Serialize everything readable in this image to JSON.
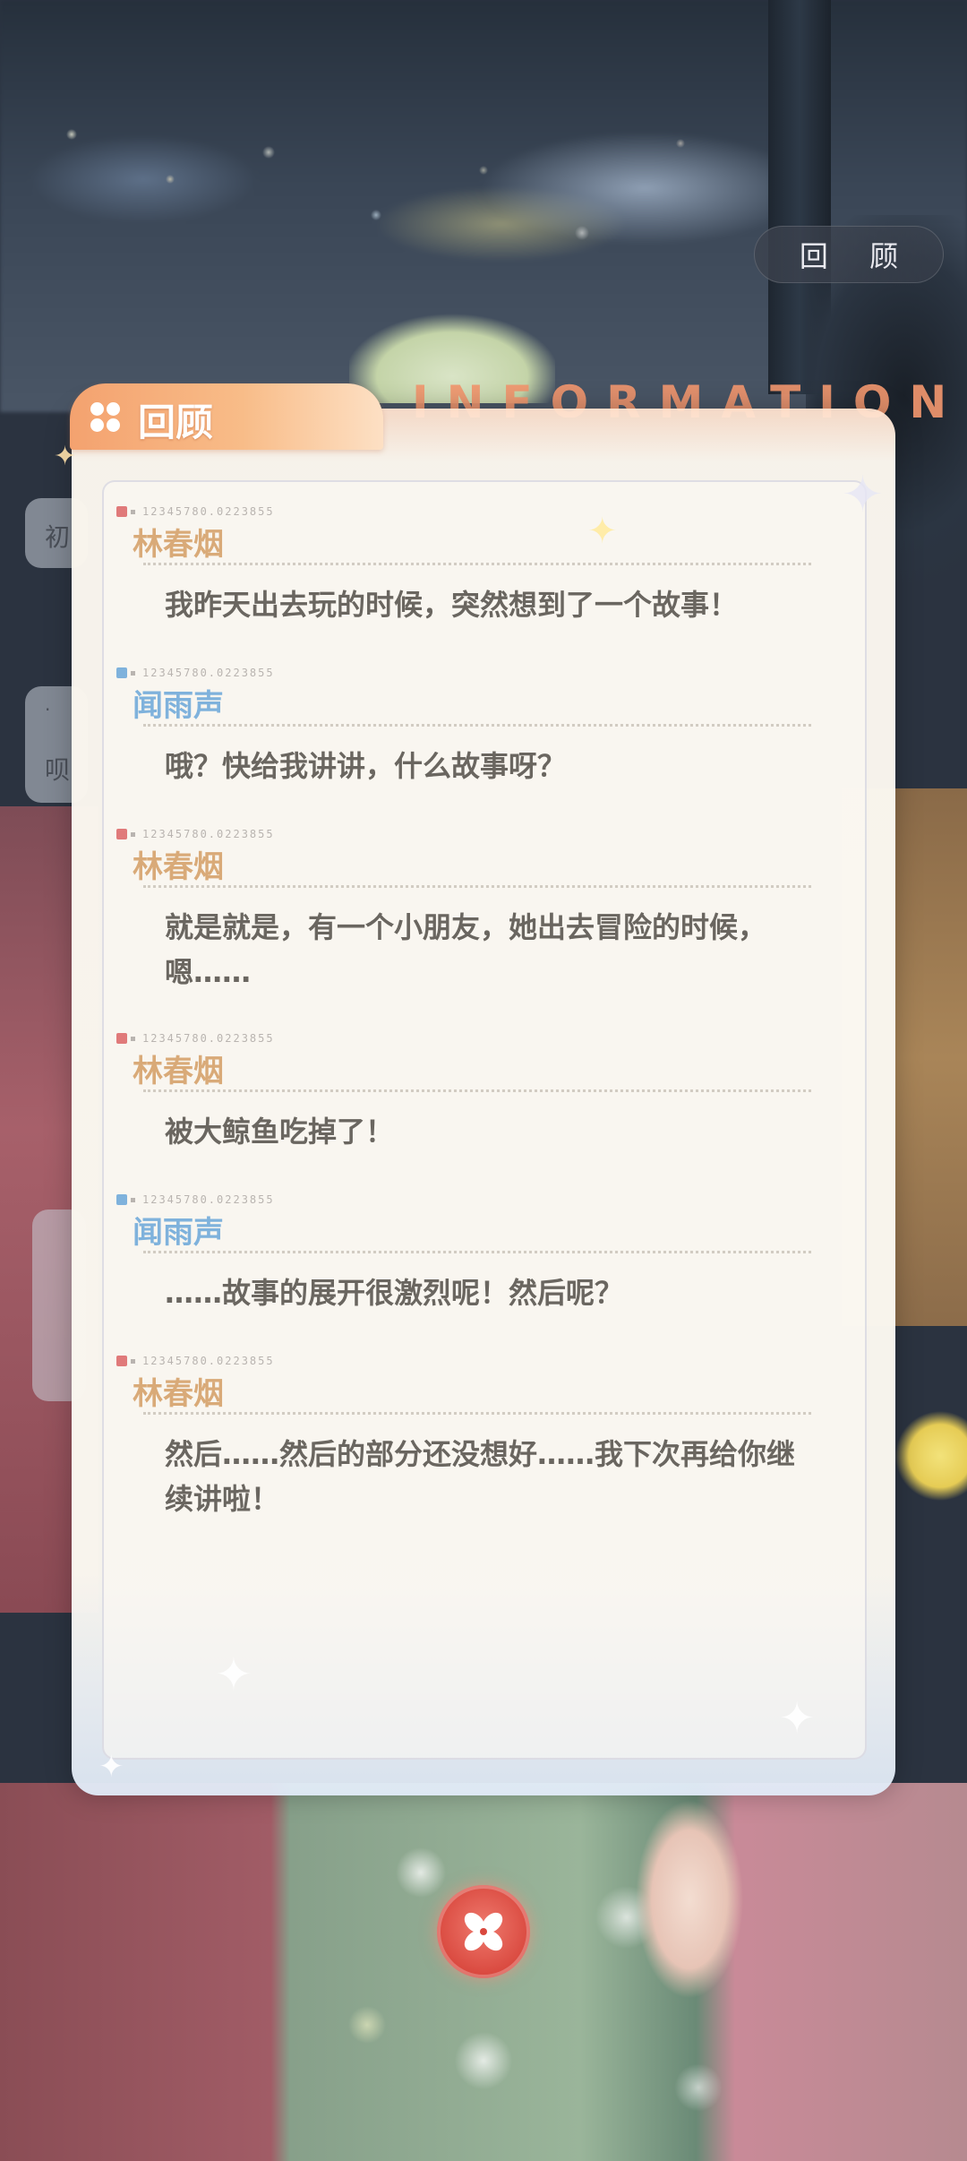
{
  "top_button": {
    "label": "回 顾"
  },
  "panel": {
    "title": "回顾",
    "decor_word": "INFORMATION"
  },
  "side_pills": [
    "初",
    "·",
    "呗"
  ],
  "colors": {
    "speaker_a": "#d9aa78",
    "speaker_b": "#7fb2dc",
    "body_text": "#6a6660",
    "close_button": "#d9483e"
  },
  "messages": [
    {
      "tag_code": "12345780.0223855",
      "speaker": "林春烟",
      "text": "我昨天出去玩的时候，突然想到了一个故事！"
    },
    {
      "tag_code": "12345780.0223855",
      "speaker": "闻雨声",
      "text": "哦？快给我讲讲，什么故事呀？"
    },
    {
      "tag_code": "12345780.0223855",
      "speaker": "林春烟",
      "text": "就是就是，有一个小朋友，她出去冒险的时候，嗯……"
    },
    {
      "tag_code": "12345780.0223855",
      "speaker": "林春烟",
      "text": "被大鲸鱼吃掉了！"
    },
    {
      "tag_code": "12345780.0223855",
      "speaker": "闻雨声",
      "text": "……故事的展开很激烈呢！然后呢？"
    },
    {
      "tag_code": "12345780.0223855",
      "speaker": "林春烟",
      "text": "然后……然后的部分还没想好……我下次再给你继续讲啦！"
    }
  ],
  "close_button": {
    "icon": "close-icon"
  }
}
